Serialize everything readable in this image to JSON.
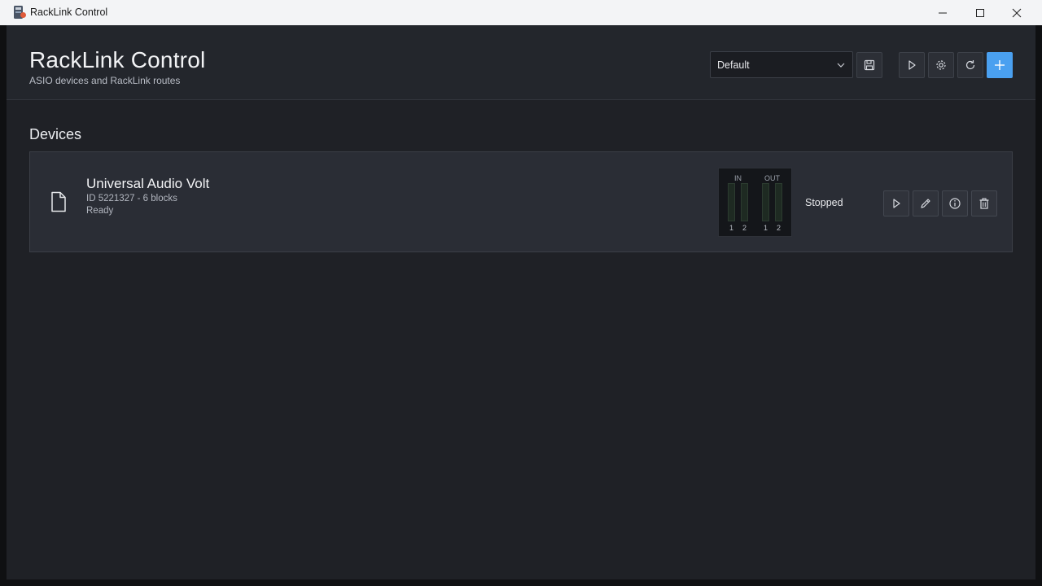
{
  "window": {
    "title": "RackLink Control"
  },
  "header": {
    "title": "RackLink Control",
    "subtitle": "ASIO devices and RackLink routes"
  },
  "toolbar": {
    "preset_value": "Default",
    "icons": [
      "save-icon",
      "play-icon",
      "gear-icon",
      "refresh-icon",
      "plus-icon"
    ],
    "accent": "#4aa0f0"
  },
  "devices": {
    "section_title": "Devices",
    "items": [
      {
        "name": "Universal Audio Volt",
        "meta": "ID  5221327  -  6 blocks",
        "state": "Ready",
        "run_status": "Stopped",
        "meters": {
          "in_label": "IN",
          "out_label": "OUT",
          "in_channels": [
            "1",
            "2"
          ],
          "out_channels": [
            "1",
            "2"
          ]
        },
        "actions": [
          "play-icon",
          "pencil-icon",
          "info-icon",
          "trash-icon"
        ]
      }
    ]
  }
}
